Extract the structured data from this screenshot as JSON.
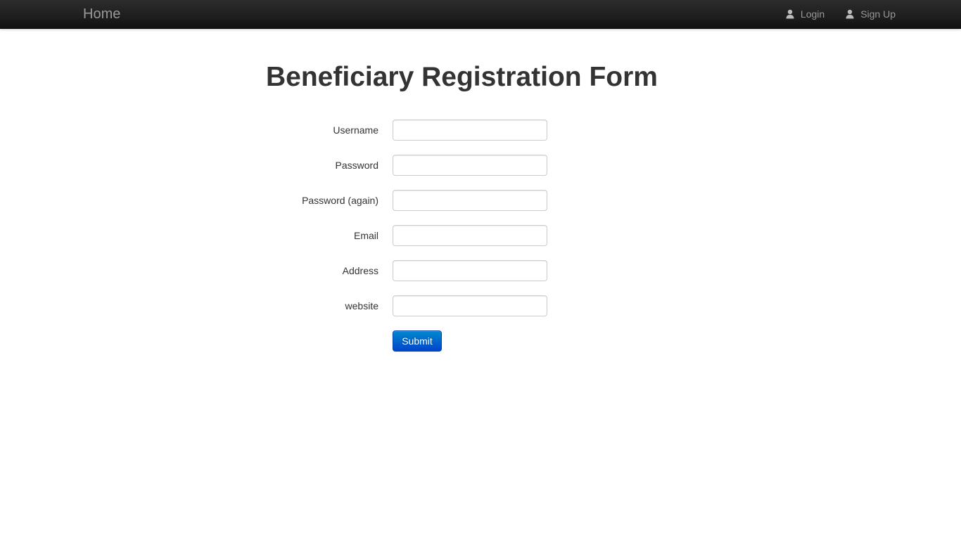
{
  "navbar": {
    "brand": "Home",
    "links": [
      {
        "label": "Login",
        "icon": "user-icon"
      },
      {
        "label": "Sign Up",
        "icon": "user-icon"
      }
    ]
  },
  "page": {
    "title": "Beneficiary Registration Form"
  },
  "form": {
    "fields": [
      {
        "label": "Username",
        "value": "",
        "placeholder": ""
      },
      {
        "label": "Password",
        "value": "",
        "placeholder": ""
      },
      {
        "label": "Password (again)",
        "value": "",
        "placeholder": ""
      },
      {
        "label": "Email",
        "value": "",
        "placeholder": ""
      },
      {
        "label": "Address",
        "value": "",
        "placeholder": ""
      },
      {
        "label": "website",
        "value": "",
        "placeholder": ""
      }
    ],
    "submit_label": "Submit"
  },
  "colors": {
    "navbar_bg": "#1b1b1b",
    "nav_text": "#999999",
    "button_primary": "#0055cc",
    "title_text": "#333333"
  }
}
